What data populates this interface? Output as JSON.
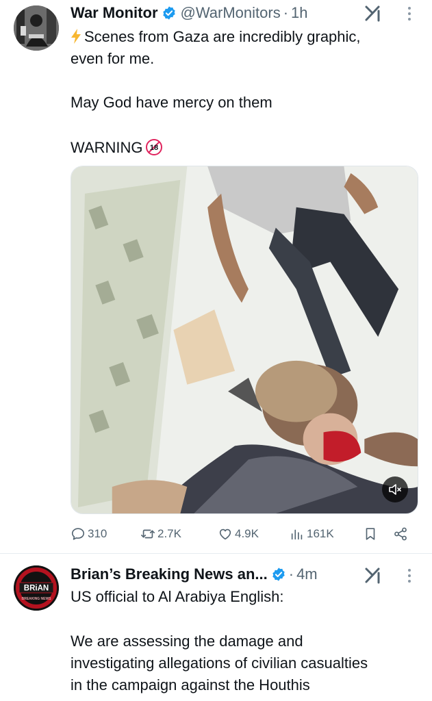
{
  "tweets": [
    {
      "author_name": "War Monitor",
      "handle": "@WarMonitors",
      "separator": "·",
      "time": "1h",
      "text_line1": "Scenes from Gaza are incredibly graphic,",
      "text_line2": "even for me.",
      "text_para2": "May God have mercy on them",
      "text_para3": "WARNING",
      "warning_badge": "18",
      "stats": {
        "replies": "310",
        "retweets": "2.7K",
        "likes": "4.9K",
        "views": "161K"
      }
    },
    {
      "author_name": "Brian’s Breaking News an...",
      "separator": "·",
      "time": "4m",
      "avatar_text": "BRiAN",
      "avatar_subtext": "BREAKING NEWS",
      "text_line1": "US official to Al Arabiya English:",
      "text_para2_line1": "We are assessing the damage and",
      "text_para2_line2": "investigating allegations of civilian casualties",
      "text_para2_line3": "in the campaign against the Houthis"
    }
  ],
  "colors": {
    "verified": "#1d9bf0",
    "text_primary": "#0f1419",
    "text_secondary": "#536471",
    "lightning": "#f7b731",
    "badge_red": "#e0245e"
  },
  "icons": [
    "verified-badge-icon",
    "grok-icon",
    "more-options-icon",
    "lightning-icon",
    "eighteen-plus-icon",
    "reply-icon",
    "retweet-icon",
    "like-icon",
    "views-icon",
    "bookmark-icon",
    "share-icon",
    "mute-icon"
  ]
}
